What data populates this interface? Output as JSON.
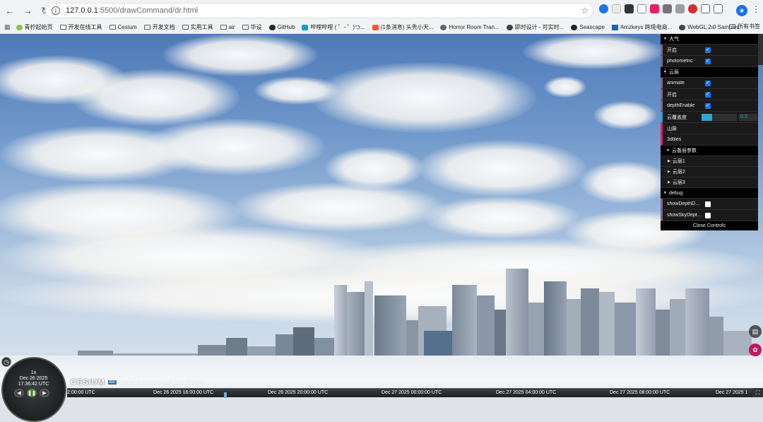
{
  "browser": {
    "url_host": "127.0.0.1",
    "url_path": ":5500/drawCommand/dr.html",
    "bookmarks": [
      {
        "label": "青柠起始页",
        "icon": "leaf-icon"
      },
      {
        "label": "开发在线工具",
        "icon": "folder-icon"
      },
      {
        "label": "Cesium",
        "icon": "folder-icon"
      },
      {
        "label": "开发文档",
        "icon": "folder-icon"
      },
      {
        "label": "实用工具",
        "icon": "folder-icon"
      },
      {
        "label": "air",
        "icon": "folder-icon"
      },
      {
        "label": "华设",
        "icon": "folder-icon"
      },
      {
        "label": "GitHub",
        "icon": "github-icon"
      },
      {
        "label": "哔哩哔哩 ( ゜- ゜)つ...",
        "icon": "bilibili-icon"
      },
      {
        "label": "(1条消息) 头秃小天...",
        "icon": "csdn-icon"
      },
      {
        "label": "Horror Room Tran...",
        "icon": "globe-icon"
      },
      {
        "label": "即时设计 - 可实时...",
        "icon": "design-icon"
      },
      {
        "label": "Seascape",
        "icon": "seascape-icon"
      },
      {
        "label": "Amzkeys 跨境电商...",
        "icon": "amz-icon"
      },
      {
        "label": "WebGL 2.0 Samples",
        "icon": "globe-icon"
      }
    ],
    "more": "»",
    "all_bookmarks": "所有书签"
  },
  "gui": {
    "folders": {
      "atmosphere": "大气",
      "clouds": "云层",
      "cloud_params": "云备层参数",
      "debug": "debug"
    },
    "atmosphere": {
      "enable": {
        "label": "开启",
        "checked": true
      },
      "photometric": {
        "label": "photometric",
        "checked": true
      }
    },
    "clouds": {
      "animate": {
        "label": "animate",
        "checked": true
      },
      "enable": {
        "label": "开启",
        "checked": true
      },
      "depthEnable": {
        "label": "depthEnable",
        "checked": true
      },
      "coverage": {
        "label": "云覆盖度",
        "value": "0.3",
        "fraction": 0.3
      },
      "mountain": "山脉",
      "tiles": "3dtiles"
    },
    "layers": [
      "云层1",
      "云层2",
      "云层3"
    ],
    "debug": {
      "showDepth": {
        "label": "showDepthDeb···",
        "checked": false
      },
      "showSky": {
        "label": "showSkyDepth···",
        "checked": false
      }
    },
    "close": "Close Controls"
  },
  "animation": {
    "speed": "1x",
    "date": "Dec 26 2025",
    "time": "17:36:42 UTC"
  },
  "credits": {
    "logo": "CESIUM",
    "ion": "ion",
    "link": "Upgrade for commercial use. Data attribution"
  },
  "timeline": {
    "ticks": [
      "2:00:00 UTC",
      "Dec 26 2025 16:00:00 UTC",
      "Dec 26 2025 20:00:00 UTC",
      "Dec 27 2025 00:00:00 UTC",
      "Dec 27 2025 04:00:00 UTC",
      "Dec 27 2025 08:00:00 UTC",
      "Dec 27 2025 1"
    ]
  }
}
